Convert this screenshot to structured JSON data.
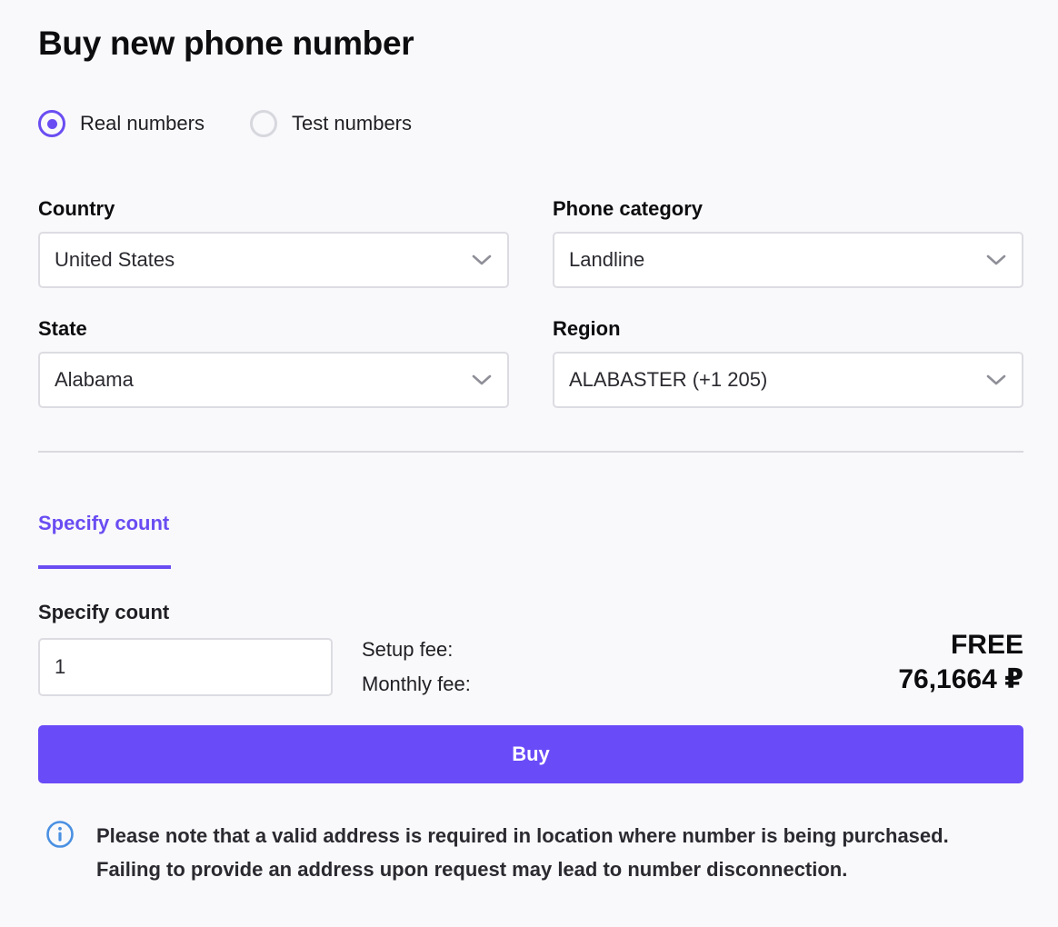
{
  "title": "Buy new phone number",
  "number_type": {
    "options": [
      {
        "label": "Real numbers",
        "selected": true
      },
      {
        "label": "Test numbers",
        "selected": false
      }
    ]
  },
  "fields": {
    "country": {
      "label": "Country",
      "value": "United States"
    },
    "phone_category": {
      "label": "Phone category",
      "value": "Landline"
    },
    "state": {
      "label": "State",
      "value": "Alabama"
    },
    "region": {
      "label": "Region",
      "value": "ALABASTER (+1 205)"
    }
  },
  "tabs": [
    {
      "label": "Specify count",
      "active": true
    }
  ],
  "count": {
    "label": "Specify count",
    "value": "1"
  },
  "fees": {
    "setup_label": "Setup fee:",
    "setup_value": "FREE",
    "monthly_label": "Monthly fee:",
    "monthly_value": "76,1664 ₽"
  },
  "buy_label": "Buy",
  "note": {
    "line1": "Please note that a valid address is required in location where number is being purchased.",
    "line2": "Failing to provide an address upon request may lead to number disconnection."
  },
  "colors": {
    "accent": "#6a4df2",
    "button": "#6a4bf8",
    "info_icon": "#4a90e2",
    "background": "#f9f9fb"
  },
  "icons": {
    "select_chevron": "chevron-down-icon",
    "note": "info-icon"
  }
}
